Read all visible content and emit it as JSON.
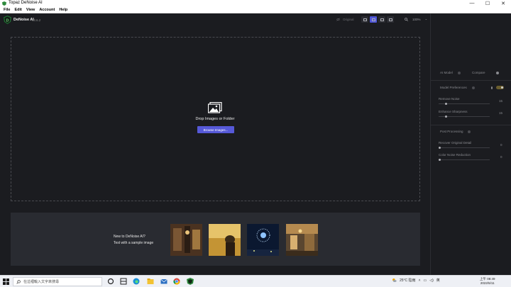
{
  "window": {
    "title": "Topaz DeNoise AI",
    "min": "—",
    "max": "☐",
    "close": "✕"
  },
  "menu": [
    "File",
    "Edit",
    "View",
    "Account",
    "Help"
  ],
  "header": {
    "app_name": "DeNoise AI",
    "version": "v3.6.2",
    "original_label": "Original",
    "zoom": "100%"
  },
  "dropzone": {
    "text": "Drop Images or Folder",
    "browse": "Browse Images..."
  },
  "samples": {
    "line1": "New to DeNoise AI?",
    "line2": "Test with a sample image"
  },
  "right_panel": {
    "ai_model": "AI Model",
    "compare": "Compare",
    "model_preferences": "Model Preferences",
    "remove_noise": {
      "label": "Remove Noise",
      "value": "15"
    },
    "enhance_sharpness": {
      "label": "Enhance Sharpness",
      "value": "15"
    },
    "post_processing": "Post Processing",
    "recover_detail": {
      "label": "Recover Original Detail",
      "value": "0"
    },
    "color_noise": {
      "label": "Color Noise Reduction",
      "value": "0"
    }
  },
  "taskbar": {
    "search_placeholder": "在這裡輸入文字來搜尋",
    "weather": "25°C 陰雨",
    "ime": "英",
    "time": "上午 08:49",
    "date": "2022/5/11"
  },
  "colors": {
    "accent": "#5659d8",
    "toggle_on": "#6b5e2e"
  }
}
